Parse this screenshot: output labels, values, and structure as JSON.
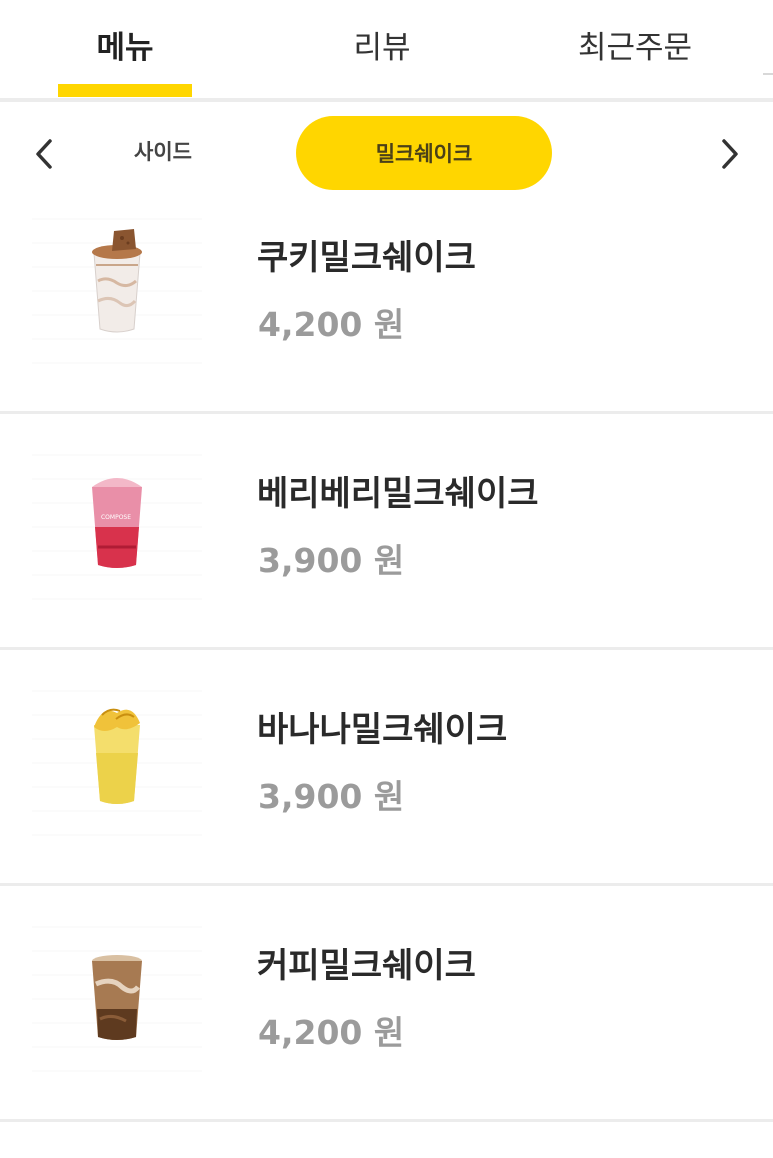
{
  "tabs": [
    {
      "label": "메뉴",
      "active": true
    },
    {
      "label": "리뷰",
      "active": false
    },
    {
      "label": "최근주문",
      "active": false
    }
  ],
  "accent_color": "#ffd600",
  "categories": {
    "prev_icon": "chevron-left-icon",
    "next_icon": "chevron-right-icon",
    "side": "사이드",
    "selected": "밀크쉐이크"
  },
  "items": [
    {
      "name": "쿠키밀크쉐이크",
      "price": "4,200 원",
      "icon": "cookie-milkshake-image"
    },
    {
      "name": "베리베리밀크쉐이크",
      "price": "3,900 원",
      "icon": "berry-milkshake-image"
    },
    {
      "name": "바나나밀크쉐이크",
      "price": "3,900 원",
      "icon": "banana-milkshake-image"
    },
    {
      "name": "커피밀크쉐이크",
      "price": "4,200 원",
      "icon": "coffee-milkshake-image"
    }
  ]
}
